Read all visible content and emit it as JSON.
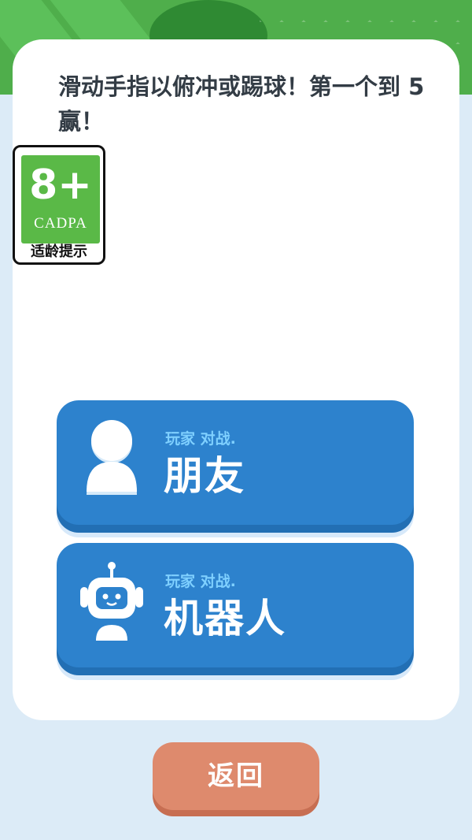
{
  "instruction": "滑动手指以俯冲或踢球！第一个到 5 赢！",
  "age_rating": {
    "age": "8+",
    "org": "CADPA",
    "caption": "适龄提示"
  },
  "modes": [
    {
      "subtitle": "玩家 对战.",
      "title": "朋友",
      "icon": "person-icon"
    },
    {
      "subtitle": "玩家 对战.",
      "title": "机器人",
      "icon": "robot-icon"
    }
  ],
  "back_label": "返回",
  "colors": {
    "button_blue": "#2d82cd",
    "subtitle_cyan": "#7fd0ff",
    "back_orange": "#de8a6d",
    "badge_green": "#5ab947",
    "page_bg": "#dcebf7"
  }
}
